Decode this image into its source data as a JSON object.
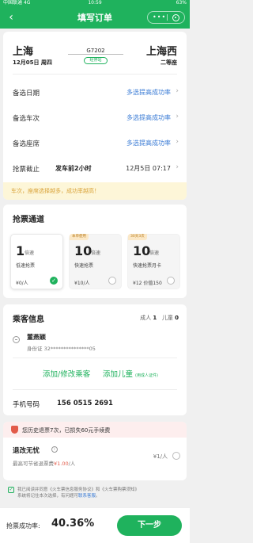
{
  "status": {
    "carrier": "中国联通",
    "network": "4G",
    "time": "10:59",
    "battery": "63%"
  },
  "nav": {
    "title": "填写订单"
  },
  "train": {
    "from": "上海",
    "to": "上海西",
    "from_date": "12月05日 周四",
    "seat_class": "二等座",
    "train_no": "G7202",
    "via": "经停站"
  },
  "options": [
    {
      "label": "备选日期",
      "value": "多选提高成功率"
    },
    {
      "label": "备选车次",
      "value": "多选提高成功率"
    },
    {
      "label": "备选座席",
      "value": "多选提高成功率"
    }
  ],
  "deadline": {
    "label": "抢票截止",
    "value": "发车前2小时",
    "datetime": "12月5日 07:17"
  },
  "tip": "车次，座席选择越多，成功率越高！",
  "grab": {
    "title": "抢票通道",
    "unit": "倍速",
    "items": [
      {
        "num": "1",
        "name": "低速抢票",
        "price": "¥0/人",
        "tag": "",
        "selected": true
      },
      {
        "num": "10",
        "name": "快速抢票",
        "price": "¥10/人",
        "tag": "本单使用",
        "selected": false
      },
      {
        "num": "10",
        "name": "快速抢票月卡",
        "price": "¥12 价值150",
        "tag": "30天3次",
        "selected": false
      }
    ]
  },
  "passenger": {
    "title": "乘客信息",
    "adult_label": "成人",
    "adult_count": "1",
    "child_label": "儿童",
    "child_count": "0",
    "name": "董燕颖",
    "id_label": "身份证",
    "id_value": "32***************05",
    "add_passenger": "添加/修改乘客",
    "add_child": "添加儿童",
    "add_child_note": "(用成人证件)",
    "phone_label": "手机号码",
    "phone": "156 0515 2691"
  },
  "insurance": {
    "banner": "您历史退票7次，已损失60元手续费",
    "title": "退改无忧",
    "sub_prefix": "最高可节省退票费",
    "sub_amount": "¥1.00",
    "sub_suffix": "/人",
    "price": "¥1/人"
  },
  "agreement": {
    "text1": "我已阅读并同意《火车票信息服务协议》和《火车票购票须知》",
    "text2": "系统将记住本次选择，有问题可",
    "link": "联系客服",
    "end": "。"
  },
  "footer": {
    "rate_label": "抢票成功率:",
    "rate": "40.36%",
    "next": "下一步"
  },
  "colors": {
    "brand": "#1fb25d",
    "link": "#3a7bd5",
    "warn": "#d9a33a",
    "danger": "#e25b4a"
  }
}
